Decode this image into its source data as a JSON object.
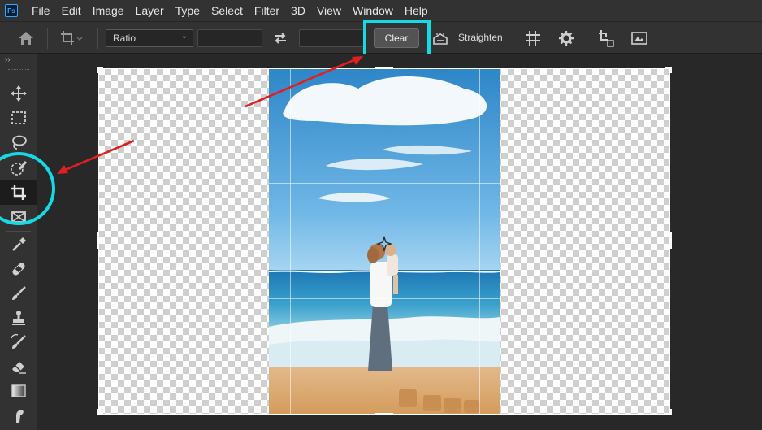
{
  "menubar": {
    "logo": "Ps",
    "items": [
      "File",
      "Edit",
      "Image",
      "Layer",
      "Type",
      "Select",
      "Filter",
      "3D",
      "View",
      "Window",
      "Help"
    ]
  },
  "options": {
    "ratio_select": "Ratio",
    "clear_label": "Clear",
    "straighten_label": "Straighten"
  },
  "toolbar": {
    "collapse": "››"
  },
  "colors": {
    "highlight": "#16d9e3",
    "arrow": "#e02020"
  }
}
